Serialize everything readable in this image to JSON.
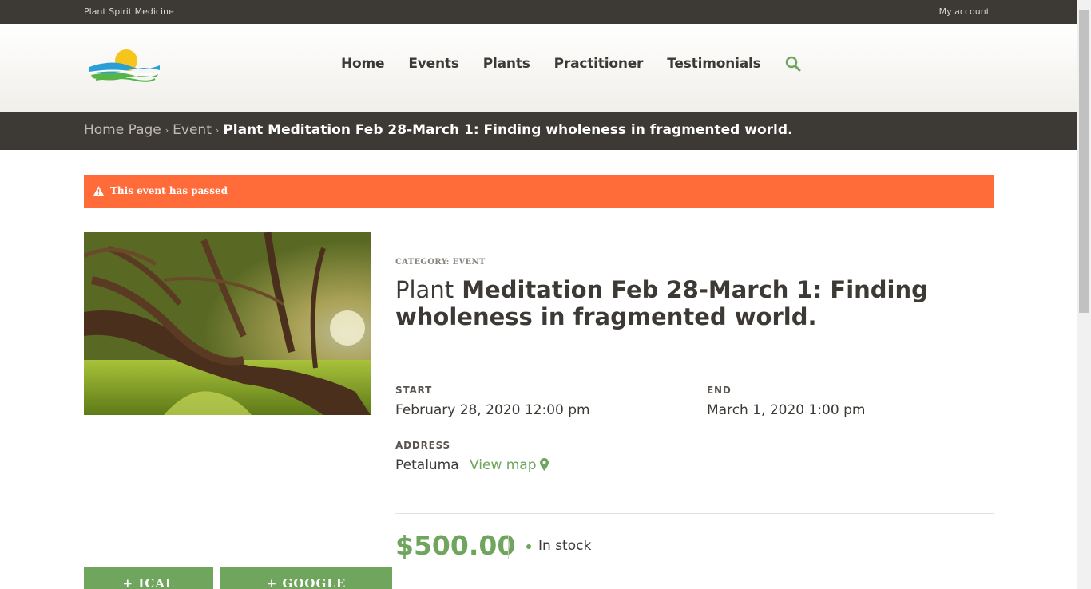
{
  "topbar": {
    "site_name": "Plant Spirit Medicine",
    "account_link": "My account"
  },
  "nav": {
    "items": [
      "Home",
      "Events",
      "Plants",
      "Practitioner",
      "Testimonials"
    ],
    "search_icon": "search-icon"
  },
  "breadcrumb": {
    "home": "Home Page",
    "sep": "›",
    "parent": "Event",
    "current": "Plant Meditation Feb 28-March 1: Finding wholeness in fragmented world."
  },
  "notice": {
    "text": "This event has passed",
    "icon": "warning-icon"
  },
  "event": {
    "category": "CATEGORY: EVENT",
    "title_first": "Plant",
    "title_rest": "Meditation Feb 28-March 1: Finding wholeness in fragmented world.",
    "start_label": "START",
    "start_value": "February 28, 2020 12:00 pm",
    "end_label": "END",
    "end_value": "March 1, 2020 1:00 pm",
    "address_label": "ADDRESS",
    "address_value": "Petaluma",
    "map_link": "View map",
    "price": "$500.00",
    "stock": "In stock"
  },
  "buttons": {
    "ical": "+ ICAL IMPORT",
    "google": "+ GOOGLE CALENDAR"
  },
  "colors": {
    "accent": "#6fa55c",
    "dark": "#3d3935",
    "notice": "#ff6b39"
  }
}
